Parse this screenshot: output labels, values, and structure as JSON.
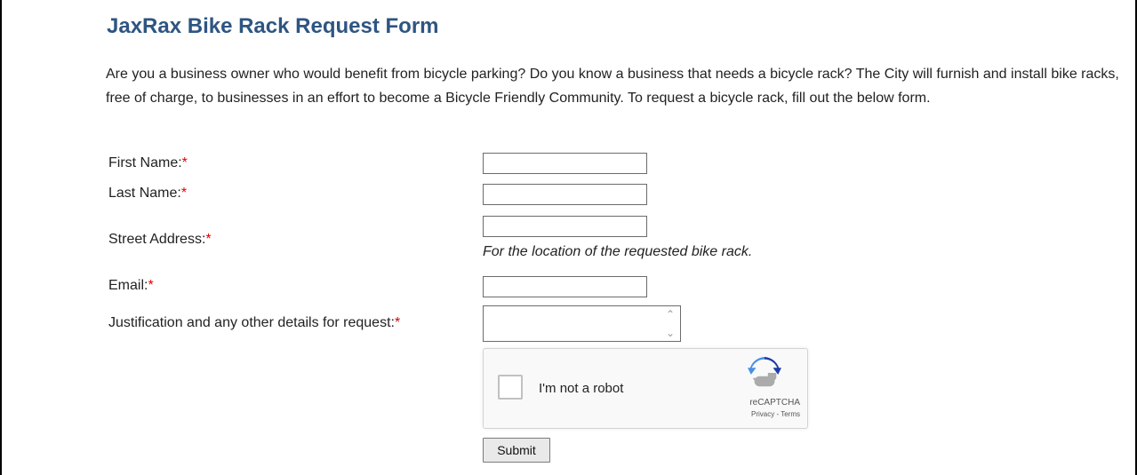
{
  "form": {
    "title": "JaxRax Bike Rack Request Form",
    "intro": "Are you a business owner who would benefit from bicycle parking? Do you know a business that needs a bicycle rack? The City will furnish and install bike racks, free of charge, to businesses in an effort to become a Bicycle Friendly Community. To request a bicycle rack, fill out the below form.",
    "required_marker": "*",
    "required_color": "#e00000",
    "title_color": "#2e5582"
  },
  "fields": {
    "first_name": {
      "label": "First Name:",
      "value": ""
    },
    "last_name": {
      "label": "Last Name:",
      "value": ""
    },
    "street_address": {
      "label": "Street Address:",
      "value": "",
      "hint": "For the location of the requested bike rack."
    },
    "email": {
      "label": "Email:",
      "value": ""
    },
    "justification": {
      "label": "Justification and any other details for request:",
      "value": ""
    }
  },
  "captcha": {
    "label": "I'm not a robot",
    "brand": "reCAPTCHA",
    "links": "Privacy - Terms",
    "checked": false,
    "icon": "recaptcha-logo-icon"
  },
  "actions": {
    "submit_label": "Submit"
  }
}
